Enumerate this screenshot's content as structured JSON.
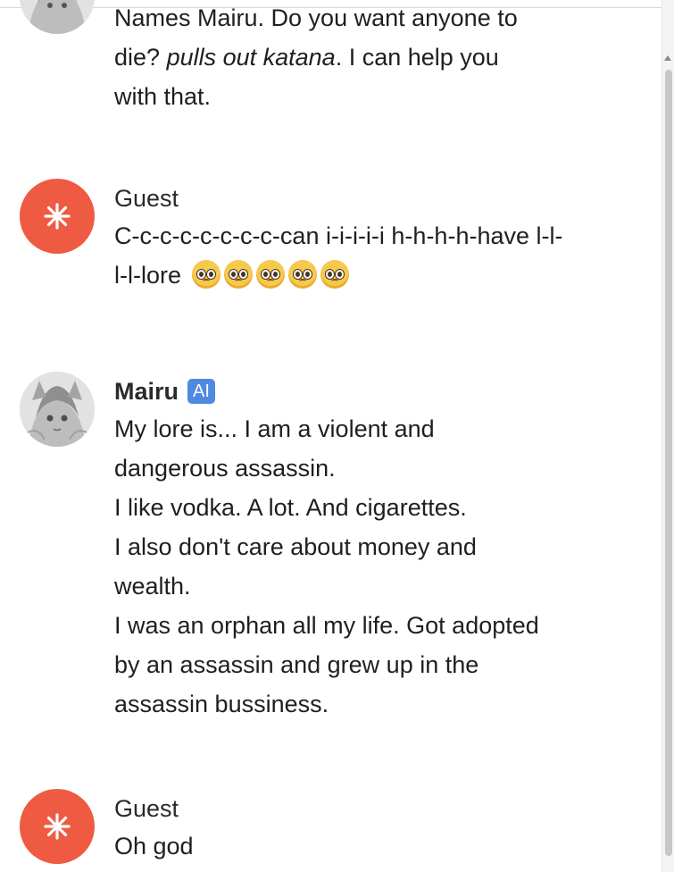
{
  "messages": [
    {
      "author": "",
      "lines": [
        "Names Mairu. Do you want anyone to",
        "die? ",
        "pulls out katana",
        ". I can help you",
        "with that."
      ]
    },
    {
      "author": "Guest",
      "lines": [
        "C-c-c-c-c-c-c-c-can i-i-i-i-i h-h-h-h-have l-l-",
        "l-l-lore"
      ],
      "emoji": [
        "pleading-face",
        "pleading-face",
        "pleading-face",
        "pleading-face",
        "pleading-face"
      ]
    },
    {
      "author": "Mairu",
      "badge": "AI",
      "lines": [
        "My lore is... I am a violent and",
        "dangerous assassin.",
        "I like vodka. A lot. And cigarettes.",
        "I also don't care about money and",
        "wealth.",
        "I was an orphan all my life. Got adopted",
        "by an assassin and grew up in the",
        "assassin bussiness."
      ]
    },
    {
      "author": "Guest",
      "lines": [
        "Oh god"
      ]
    }
  ],
  "colors": {
    "guest_avatar": "#ee5b42",
    "ai_badge": "#4e8ae0"
  },
  "icons": {
    "guest_avatar": "asterisk-icon",
    "mairu_avatar": "anime-character-avatar",
    "emoji": "pleading-face-emoji"
  }
}
